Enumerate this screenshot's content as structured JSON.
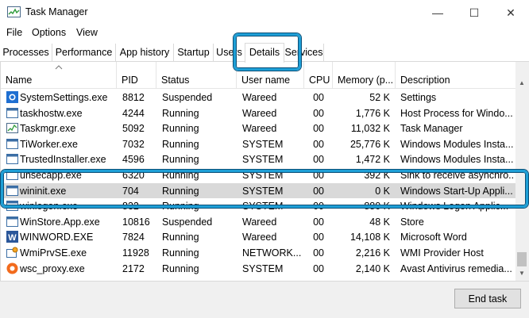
{
  "window": {
    "title": "Task Manager",
    "icon": "task-manager-icon",
    "controls": {
      "minimize": "—",
      "maximize": "☐",
      "close": "✕"
    }
  },
  "menu": [
    "File",
    "Options",
    "View"
  ],
  "tabs": [
    {
      "label": "Processes"
    },
    {
      "label": "Performance"
    },
    {
      "label": "App history"
    },
    {
      "label": "Startup"
    },
    {
      "label": "Users"
    },
    {
      "label": "Details",
      "active": true
    },
    {
      "label": "Services"
    }
  ],
  "columns": [
    "Name",
    "PID",
    "Status",
    "User name",
    "CPU",
    "Memory (p...",
    "Description"
  ],
  "sort": {
    "column": "Name",
    "direction": "ascending"
  },
  "rows": [
    {
      "name": "SystemSettings.exe",
      "pid": "8812",
      "status": "Suspended",
      "user": "Wareed",
      "cpu": "00",
      "memory": "52 K",
      "description": "Settings",
      "icon": "settings-gear-icon"
    },
    {
      "name": "taskhostw.exe",
      "pid": "4244",
      "status": "Running",
      "user": "Wareed",
      "cpu": "00",
      "memory": "1,776 K",
      "description": "Host Process for Windo...",
      "icon": "app-window-icon"
    },
    {
      "name": "Taskmgr.exe",
      "pid": "5092",
      "status": "Running",
      "user": "Wareed",
      "cpu": "00",
      "memory": "11,032 K",
      "description": "Task Manager",
      "icon": "task-manager-icon"
    },
    {
      "name": "TiWorker.exe",
      "pid": "7032",
      "status": "Running",
      "user": "SYSTEM",
      "cpu": "00",
      "memory": "25,776 K",
      "description": "Windows Modules Insta...",
      "icon": "app-window-icon"
    },
    {
      "name": "TrustedInstaller.exe",
      "pid": "4596",
      "status": "Running",
      "user": "SYSTEM",
      "cpu": "00",
      "memory": "1,472 K",
      "description": "Windows Modules Insta...",
      "icon": "app-window-icon"
    },
    {
      "name": "unsecapp.exe",
      "pid": "6320",
      "status": "Running",
      "user": "SYSTEM",
      "cpu": "00",
      "memory": "392 K",
      "description": "Sink to receive asynchro...",
      "icon": "app-window-icon",
      "obscured": true
    },
    {
      "name": "wininit.exe",
      "pid": "704",
      "status": "Running",
      "user": "SYSTEM",
      "cpu": "00",
      "memory": "0 K",
      "description": "Windows Start-Up Appli...",
      "icon": "app-window-icon",
      "selected": true
    },
    {
      "name": "winlogon.exe",
      "pid": "832",
      "status": "Running",
      "user": "SYSTEM",
      "cpu": "00",
      "memory": "880 K",
      "description": "Windows Logon Applic...",
      "icon": "app-window-icon",
      "obscured": true
    },
    {
      "name": "WinStore.App.exe",
      "pid": "10816",
      "status": "Suspended",
      "user": "Wareed",
      "cpu": "00",
      "memory": "48 K",
      "description": "Store",
      "icon": "app-window-icon"
    },
    {
      "name": "WINWORD.EXE",
      "pid": "7824",
      "status": "Running",
      "user": "Wareed",
      "cpu": "00",
      "memory": "14,108 K",
      "description": "Microsoft Word",
      "icon": "word-icon"
    },
    {
      "name": "WmiPrvSE.exe",
      "pid": "11928",
      "status": "Running",
      "user": "NETWORK...",
      "cpu": "00",
      "memory": "2,216 K",
      "description": "WMI Provider Host",
      "icon": "wmi-gear-icon"
    },
    {
      "name": "wsc_proxy.exe",
      "pid": "2172",
      "status": "Running",
      "user": "SYSTEM",
      "cpu": "00",
      "memory": "2,140 K",
      "description": "Avast Antivirus  remedia...",
      "icon": "avast-icon"
    }
  ],
  "footer": {
    "end_task_label": "End task",
    "end_task_accesskey": "E"
  },
  "colors": {
    "highlight": "#1e9fd6",
    "selection": "#d9d9d9",
    "icon_blue": "#1f6fd1",
    "avast_orange": "#f26b1d",
    "word_blue": "#2b579a"
  }
}
